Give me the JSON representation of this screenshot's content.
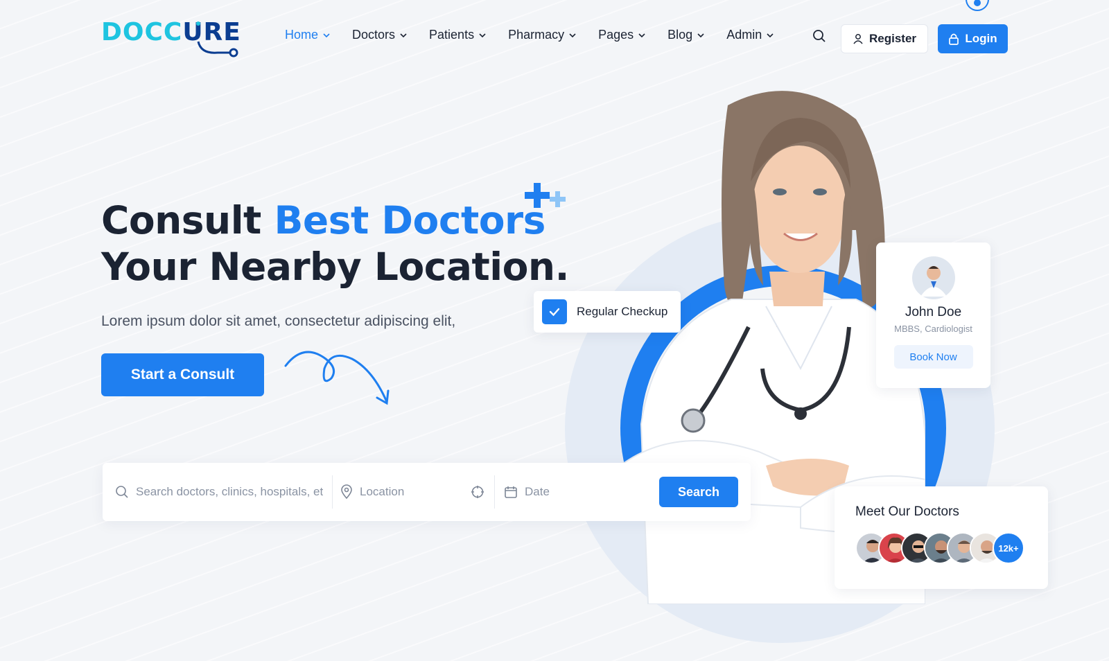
{
  "brand": {
    "logo_doc": "DOCC",
    "logo_cure": "URE"
  },
  "nav": {
    "items": [
      {
        "label": "Home",
        "active": true
      },
      {
        "label": "Doctors"
      },
      {
        "label": "Patients"
      },
      {
        "label": "Pharmacy"
      },
      {
        "label": "Pages"
      },
      {
        "label": "Blog"
      },
      {
        "label": "Admin"
      }
    ],
    "register_label": "Register",
    "login_label": "Login"
  },
  "hero": {
    "headline_part1": "Consult ",
    "headline_highlight": "Best Doctors",
    "headline_line2": "Your Nearby Location.",
    "subtext": "Lorem ipsum dolor sit amet, consectetur adipiscing elit,",
    "cta_label": "Start a Consult"
  },
  "checkup": {
    "label": "Regular Checkup"
  },
  "doctor_card": {
    "name": "John Doe",
    "specialty": "MBBS, Cardiologist",
    "book_label": "Book Now"
  },
  "meet": {
    "title": "Meet Our Doctors",
    "count": "12k+"
  },
  "search": {
    "query_placeholder": "Search doctors, clinics, hospitals, etc",
    "location_placeholder": "Location",
    "date_placeholder": "Date",
    "button_label": "Search"
  },
  "colors": {
    "primary": "#1f7ff0",
    "logo_cyan": "#1ec4e0",
    "logo_navy": "#0b3d91",
    "text_dark": "#1b2333"
  }
}
